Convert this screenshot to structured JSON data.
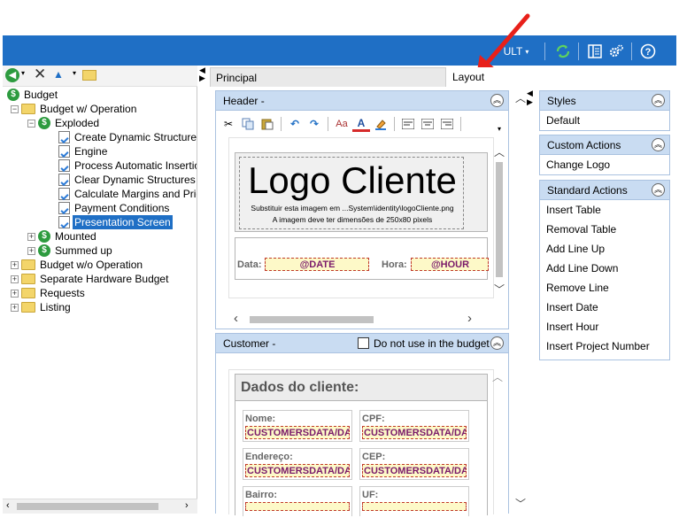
{
  "topbar": {
    "default_label": "ULT",
    "colors": {
      "bar": "#1f6fc5"
    }
  },
  "tree_toolbar": {
    "icons": [
      "back-icon",
      "close-icon",
      "move-up-icon",
      "folder-open-icon"
    ]
  },
  "tree": {
    "root": "Budget",
    "operation": "Budget w/ Operation",
    "exploded": "Exploded",
    "items": [
      "Create Dynamic Structures",
      "Engine",
      "Process Automatic Insertion",
      "Clear Dynamic Structures",
      "Calculate Margins and Prices",
      "Payment Conditions",
      "Presentation Screen"
    ],
    "mounted": "Mounted",
    "summed_up": "Summed up",
    "wo_operation": "Budget w/o Operation",
    "separate_hw": "Separate Hardware Budget",
    "requests": "Requests",
    "listing": "Listing"
  },
  "tabs": {
    "principal": "Principal",
    "layout": "Layout"
  },
  "header_panel": {
    "title": "Header -",
    "logo_text": "Logo Cliente",
    "logo_line1": "Substituir esta imagem em ...System\\identity\\logoCliente.png",
    "logo_line2": "A imagem deve ter dimensões de 250x80 pixels",
    "date_label": "Data:",
    "date_value": "@DATE",
    "hour_label": "Hora:",
    "hour_value": "@HOUR"
  },
  "customer_panel": {
    "title": "Customer -",
    "checkbox_label": "Do not use in the budget",
    "section_title": "Dados do cliente:",
    "fields": {
      "nome": "Nome:",
      "cpf": "CPF:",
      "endereco": "Endereço:",
      "cep": "CEP:",
      "bairro": "Bairro:",
      "uf": "UF:"
    },
    "field_value": "CUSTOMERSDATA/DAT"
  },
  "side": {
    "styles_title": "Styles",
    "styles_default": "Default",
    "custom_title": "Custom Actions",
    "custom_change_logo": "Change Logo",
    "standard_title": "Standard Actions",
    "standard_items": [
      "Insert Table",
      "Removal Table",
      "Add Line Up",
      "Add Line Down",
      "Remove Line",
      "Insert Date",
      "Insert Hour",
      "Insert Project Number"
    ]
  }
}
